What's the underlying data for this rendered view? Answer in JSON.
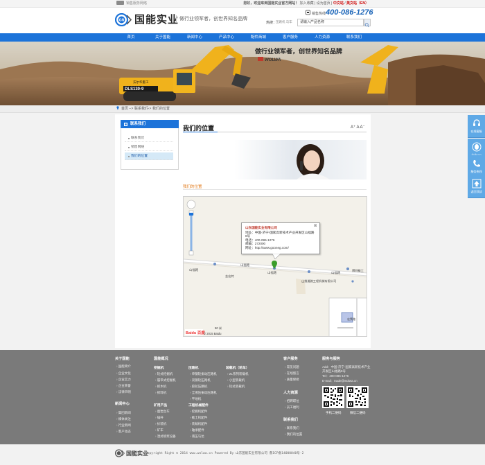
{
  "topbar": {
    "tagline": "销售服务网络",
    "links": [
      "您好，欢迎来到国能实业官方网站！",
      "加入收藏",
      "设为首页"
    ],
    "lang_cn": "中文站",
    "lang_en": "英文站（EN）"
  },
  "header": {
    "logo_text": "国能实业",
    "slogan": "做行业领军者，创世界知名品牌",
    "hotline_label": "销售热线",
    "hotline": "400-086-1276",
    "search_label": "热搜：",
    "search_hot": "压路机 马车",
    "search_placeholder": "请输入产品名称"
  },
  "nav": {
    "items": [
      "首页",
      "关于国能",
      "新闻中心",
      "产品中心",
      "配件商城",
      "客户服务",
      "人力资源",
      "联系我们"
    ]
  },
  "banner": {
    "headline": "做行业领军者，创世界知名品牌",
    "brand": "WOLWA",
    "machine_model": "DLS130-9",
    "machine_brand": "沃尔华重工"
  },
  "breadcrumb": {
    "home": "首页",
    "sep": "-->",
    "level1": "联系我们",
    "level2": "我们的位置"
  },
  "sidebar": {
    "title": "联系我们",
    "items": [
      {
        "label": "联系我们",
        "active": false
      },
      {
        "label": "销售网络",
        "active": false
      },
      {
        "label": "我们的位置",
        "active": true
      }
    ]
  },
  "content": {
    "title": "我们的位置",
    "font_size_controls": "A⁺ A A⁻",
    "section_label": "我们的位置"
  },
  "map": {
    "popup_title": "山东国能实业有限公司",
    "popup_lines": [
      "地址：中国-济宁-国家高新技术产业开发区山福路8号",
      "电话：400-086-1276",
      "邮编：272000",
      "网址：http://www.gooneg.com/"
    ],
    "roads": [
      "山福路",
      "山福路",
      "山福路",
      "山福路"
    ],
    "places": [
      "金宏特",
      "山推道路工程机械有限公司",
      "博特精工"
    ],
    "scale": "50 米",
    "copyright": "© 2015 Baidu",
    "baidu_logo": "Baidu 百度",
    "inset_label": "宏策路"
  },
  "footer": {
    "columns": [
      {
        "title": "关于国能",
        "links": [
          "国能简介",
          "企业文化",
          "企业实力",
          "企业荣誉",
          "法律声明"
        ]
      },
      {
        "title": "新闻中心",
        "links": [
          "集团新闻",
          "媒体关注",
          "行业新闻",
          "客户动态"
        ]
      },
      {
        "title": "国能概况",
        "sub": "挖掘机",
        "links": [
          "轮式挖掘机",
          "履带式挖掘机",
          "抓木机",
          "抓料机"
        ]
      },
      {
        "title": "矿用产品",
        "links": [
          "凿岩台车",
          "锚杆",
          "扒装机",
          "矿车",
          "湿式喷浆设备"
        ]
      },
      {
        "sub": "压路机",
        "links": [
          "单钢轮振动压路机",
          "双钢轮压路机",
          "胶轮压路机",
          "全液压振动压路机",
          "平地机"
        ]
      },
      {
        "sub": "工程机械配件",
        "links": [
          "挖掘机配件",
          "推土机配件",
          "装载机配件",
          "轴承配件",
          "液压马达"
        ]
      },
      {
        "sub": "装载机（轮车）",
        "links": [
          "ZL系列装载机",
          "小型装载机",
          "轮式装载机"
        ]
      },
      {
        "title": "客户服务",
        "links": [
          "常见问题",
          "在线留言",
          "质量保修"
        ]
      },
      {
        "title": "人力资源",
        "links": [
          "招聘职位",
          "员工福利"
        ]
      },
      {
        "title": "联系我们",
        "links": [
          "联系我们",
          "我们的位置"
        ]
      }
    ],
    "contact_title": "服务与服务",
    "contact_lines": [
      "Add：中国-济宁-国家高新技术产业开发区山福路8号",
      "Tel：400-086-1276",
      "E-mail：trade@wolwa.cn"
    ],
    "qr_labels": [
      "手机二维码",
      "微信二维码"
    ]
  },
  "bottom": {
    "logo_text": "国能实业",
    "copyright": "Copyright Right © 2014 www.wolwa.cn Powered By 山东国能实业有限公司 鲁ICP备14000040号-2"
  },
  "float": {
    "items": [
      "在线客服",
      "企业QQ",
      "服务热线",
      "返回顶部"
    ]
  },
  "colors": {
    "primary_blue": "#1c73d9",
    "accent_orange": "#e27a1a",
    "footer_gray": "#7a7a7a",
    "hotline_blue": "#1b65b8"
  }
}
